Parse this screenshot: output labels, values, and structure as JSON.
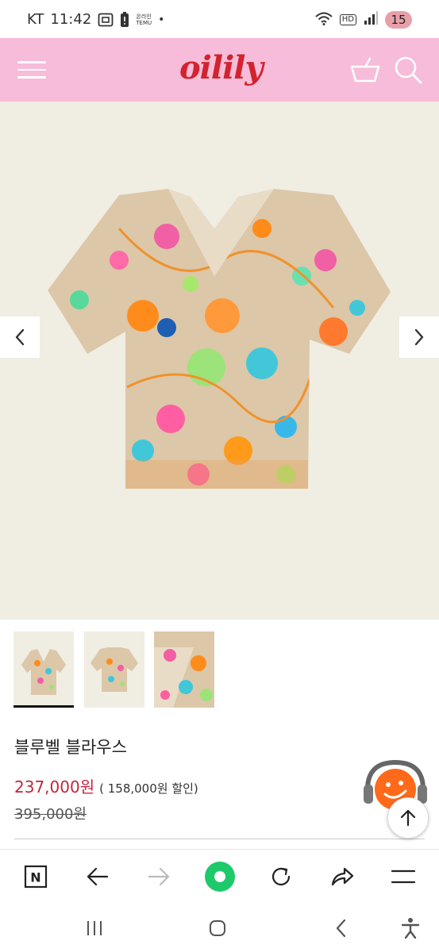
{
  "status_bar": {
    "carrier": "KT",
    "time": "11:42",
    "temu_line1": "온라인",
    "temu_line2": "TEMU",
    "dot": "•",
    "hd": "HD",
    "battery": "15"
  },
  "header": {
    "logo": "oilily"
  },
  "product": {
    "name": "블루벨 블라우스",
    "price": "237,000원",
    "discount": "( 158,000원 할인)",
    "original_price": "395,000원"
  },
  "colors": {
    "header_bg": "#f7bcd9",
    "logo": "#d2232f",
    "price": "#c0283e",
    "image_bg": "#f0ede3",
    "browser_home": "#1ec96a"
  },
  "icons": {
    "menu": "hamburger-icon",
    "cart": "basket-icon",
    "search": "search-icon",
    "prev": "chevron-left-icon",
    "next": "chevron-right-icon",
    "top": "arrow-up-icon",
    "chat": "chatbot-icon",
    "naver": "naver-n-icon",
    "back": "arrow-left-icon",
    "forward": "arrow-right-icon",
    "home": "green-dot-icon",
    "reload": "reload-icon",
    "share": "share-icon",
    "more": "menu-lines-icon"
  },
  "naver_letter": "N"
}
